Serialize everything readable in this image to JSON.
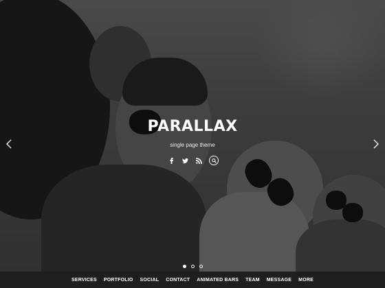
{
  "hero": {
    "title": "PARALLAX",
    "subtitle": "single page theme"
  },
  "social": {
    "icons": [
      "facebook-icon",
      "twitter-icon",
      "rss-icon",
      "search-icon"
    ]
  },
  "slider": {
    "total_slides": 3,
    "active_index": 0
  },
  "nav": {
    "items": [
      "SERVICES",
      "PORTFOLIO",
      "SOCIAL",
      "CONTACT",
      "ANIMATED BARS",
      "TEAM",
      "MESSAGE",
      "MORE"
    ]
  },
  "colors": {
    "navbar_bg": "#1e1e1e",
    "text": "#ffffff"
  }
}
